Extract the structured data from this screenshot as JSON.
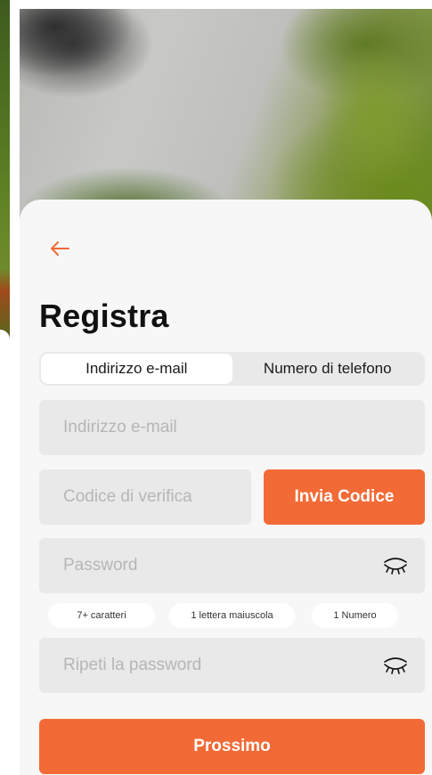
{
  "header": {
    "back_icon": "arrow-left-icon",
    "title": "Registra"
  },
  "tabs": [
    {
      "label": "Indirizzo e-mail",
      "active": true
    },
    {
      "label": "Numero di telefono",
      "active": false
    }
  ],
  "form": {
    "email_placeholder": "Indirizzo e-mail",
    "code_placeholder": "Codice di verifica",
    "send_code_label": "Invia Codice",
    "password_placeholder": "Password",
    "repeat_password_placeholder": "Ripeti la password",
    "password_toggle_icon": "eye-closed-icon",
    "requirements": [
      "7+ caratteri",
      "1 lettera maiuscola",
      "1 Numero"
    ],
    "next_label": "Prossimo"
  },
  "colors": {
    "accent": "#f26a36",
    "sheet_background": "#f7f7f7",
    "field_background": "#e9e9e9"
  }
}
